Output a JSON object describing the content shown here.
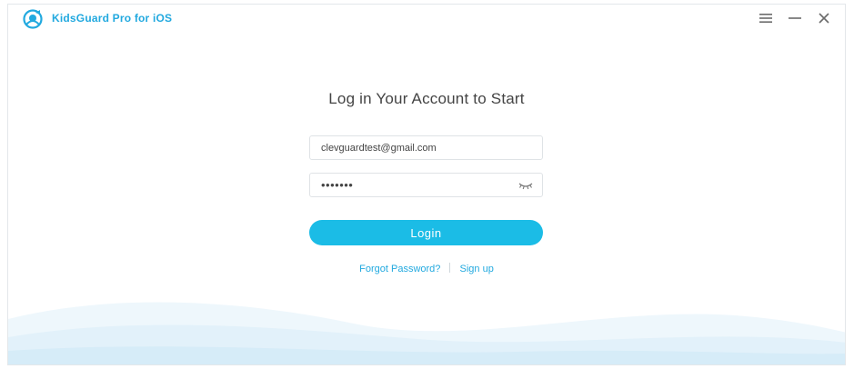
{
  "titlebar": {
    "app_title": "KidsGuard Pro for iOS",
    "logo_icon": "kidsguard-logo-icon",
    "menu_icon": "hamburger-menu-icon",
    "minimize_icon": "minimize-icon",
    "close_icon": "close-icon"
  },
  "login": {
    "heading": "Log in Your Account to Start",
    "email_value": "clevguardtest@gmail.com",
    "password_value": "•••••••",
    "password_toggle_icon": "eye-closed-icon",
    "login_button": "Login",
    "forgot_password": "Forgot Password?",
    "sign_up": "Sign up"
  },
  "colors": {
    "accent": "#1bbce6",
    "link": "#22a9df",
    "heading_text": "#444444",
    "border": "#dfe3e6"
  }
}
